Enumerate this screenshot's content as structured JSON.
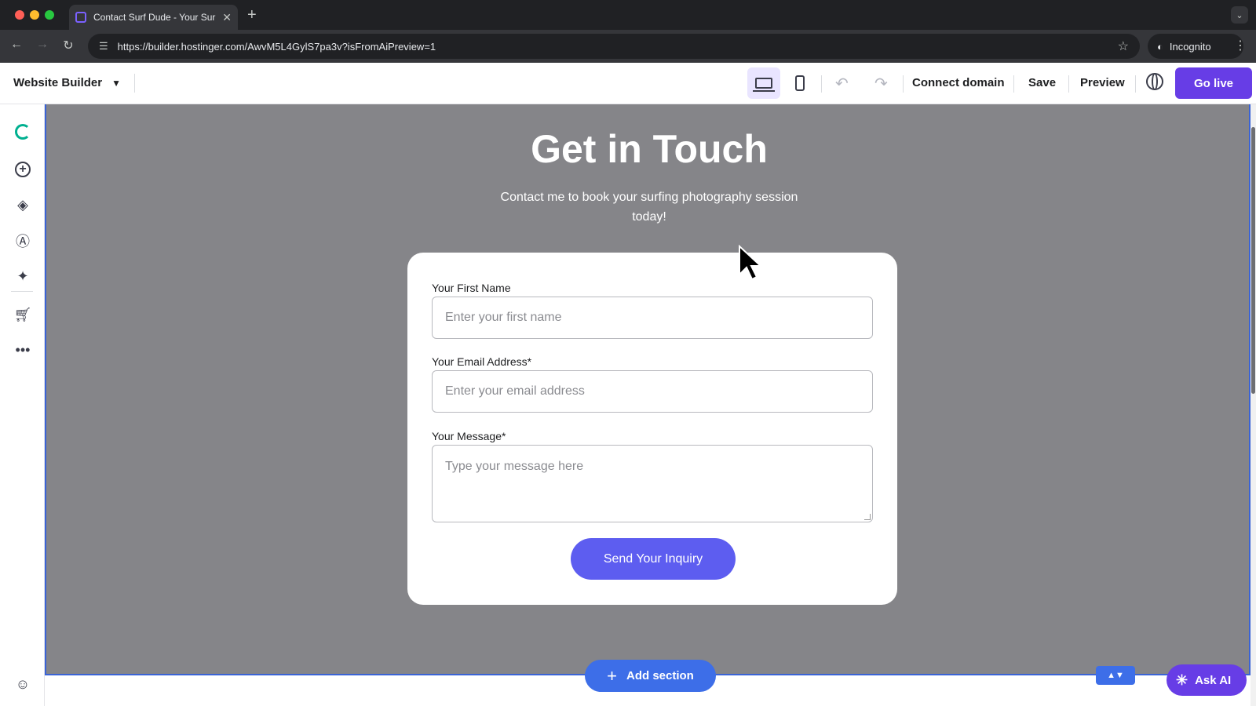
{
  "browser": {
    "tab_title": "Contact Surf Dude - Your Sur",
    "url": "https://builder.hostinger.com/AwvM5L4GylS7pa3v?isFromAiPreview=1",
    "incognito_label": "Incognito"
  },
  "builder_top": {
    "app_title": "Website Builder",
    "connect_domain": "Connect domain",
    "save": "Save",
    "preview": "Preview",
    "go_live": "Go live"
  },
  "section": {
    "title": "Get in Touch",
    "subtitle": "Contact me to book your surfing photography session today!"
  },
  "form": {
    "first_name_label": "Your First Name",
    "first_name_placeholder": "Enter your first name",
    "email_label": "Your Email Address*",
    "email_placeholder": "Enter your email address",
    "message_label": "Your Message*",
    "message_placeholder": "Type your message here",
    "submit_label": "Send Your Inquiry"
  },
  "bottom": {
    "add_section": "Add section",
    "ask_ai": "Ask AI"
  },
  "colors": {
    "primary": "#673de6",
    "canvas_bg": "#858589",
    "form_button": "#5d5df0",
    "add_section_button": "#3d6ee8"
  }
}
